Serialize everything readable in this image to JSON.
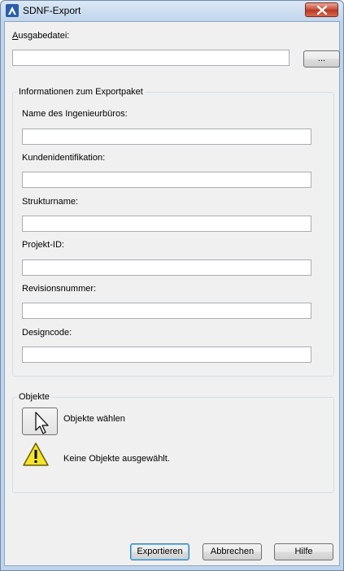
{
  "window": {
    "title": "SDNF-Export"
  },
  "output": {
    "label": "Ausgabedatei:",
    "value": "",
    "browse_label": "..."
  },
  "export_package": {
    "title": "Informationen zum Exportpaket",
    "fields": [
      {
        "label": "Name des Ingenieurbüros:",
        "value": ""
      },
      {
        "label": "Kundenidentifikation:",
        "value": ""
      },
      {
        "label": "Strukturname:",
        "value": ""
      },
      {
        "label": "Projekt-ID:",
        "value": ""
      },
      {
        "label": "Revisionsnummer:",
        "value": ""
      },
      {
        "label": "Designcode:",
        "value": ""
      }
    ]
  },
  "objects": {
    "title": "Objekte",
    "select_label": "Objekte wählen",
    "status": "Keine Objekte ausgewählt.",
    "status_icon": "warning-icon",
    "select_icon": "cursor-arrow-icon"
  },
  "buttons": {
    "export": "Exportieren",
    "cancel": "Abbrechen",
    "help": "Hilfe"
  },
  "colors": {
    "title_bar": "#c3d6ec",
    "close_button": "#c74a33",
    "warning": "#f5e52a"
  }
}
